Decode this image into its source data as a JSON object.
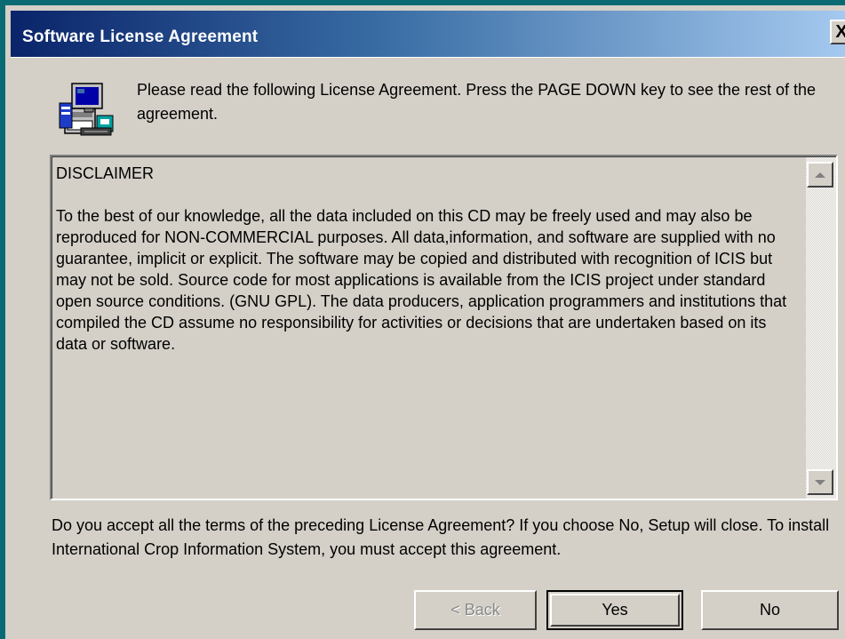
{
  "window": {
    "title": "Software License Agreement",
    "close_glyph": "X"
  },
  "header": {
    "icon": "setup-computer-icon",
    "intro_text": "Please read the following License Agreement.  Press the PAGE DOWN key to see the rest of the agreement."
  },
  "license": {
    "heading": "DISCLAIMER",
    "body": "To the best of our knowledge, all the data included on this CD may be freely used and may also be reproduced for NON-COMMERCIAL purposes.  All data,information, and software are supplied with no guarantee, implicit or explicit.  The software may be copied and distributed with recognition of ICIS but may not be sold.  Source code for most applications is available from the ICIS project under standard open source conditions. (GNU GPL).  The data producers, application programmers and institutions that compiled the CD assume no responsibility for activities or decisions that are undertaken based on its data or software."
  },
  "question_text": "Do you accept all the terms of the preceding License Agreement?  If you choose No,  Setup will close.  To install International Crop Information System, you must accept this agreement.",
  "buttons": {
    "back": "< Back",
    "yes": "Yes",
    "no": "No"
  },
  "colors": {
    "titlebar_start": "#0A246A",
    "titlebar_end": "#A6CAF0",
    "dialog_face": "#D4D0C8",
    "frame": "#0A6A73"
  }
}
